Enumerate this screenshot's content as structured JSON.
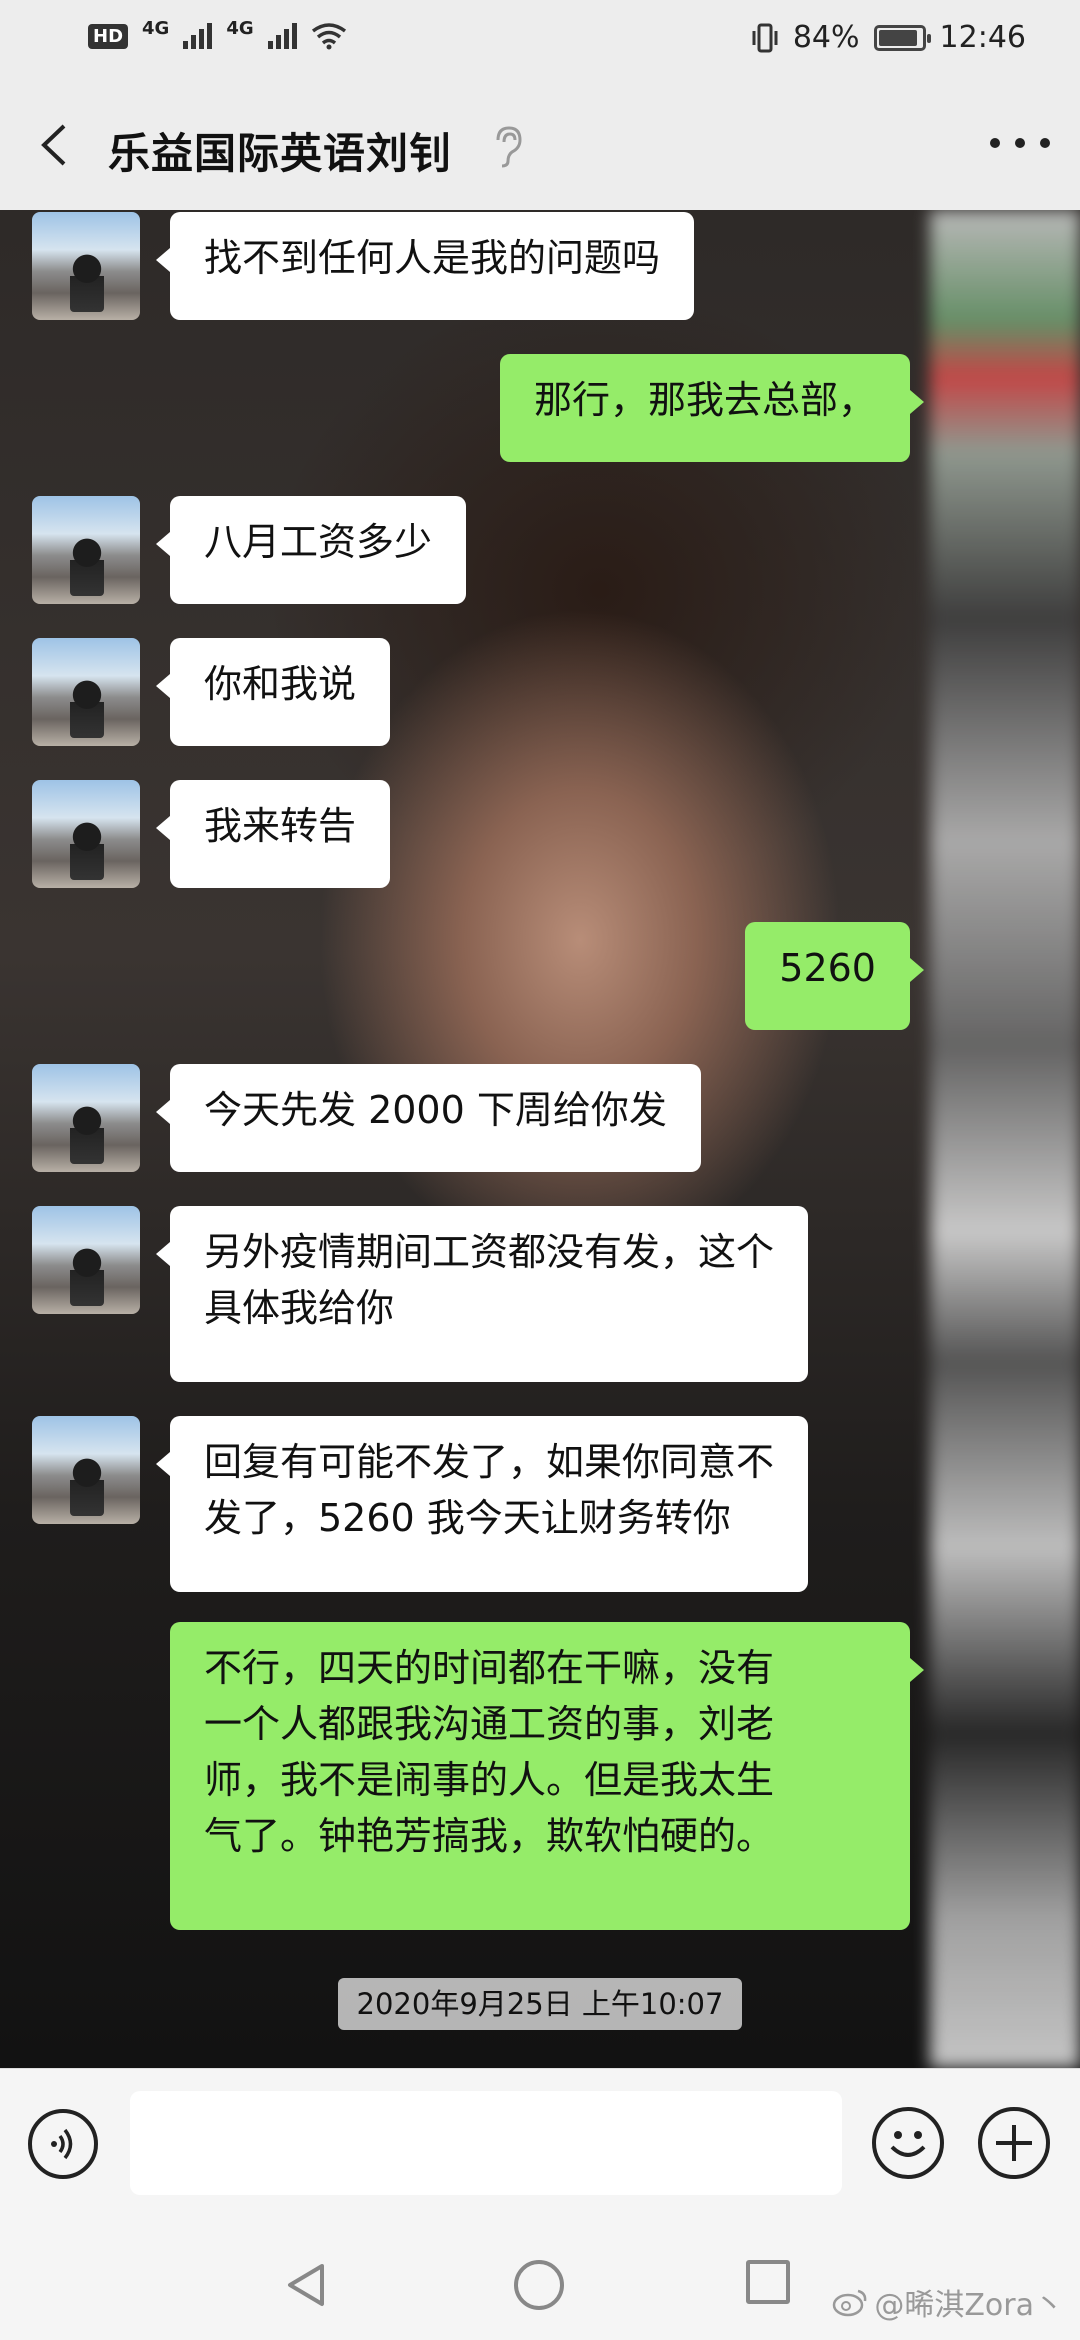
{
  "status_bar": {
    "hd_badge": "HD",
    "network_1": "4G",
    "network_2": "4G",
    "battery_text": "84%",
    "battery_level": 0.84,
    "time": "12:46"
  },
  "header": {
    "title": "乐益国际英语刘钊",
    "back_icon": "chevron-left-icon",
    "ear_icon": "earpiece-mode-icon",
    "more_icon": "more-dots-icon"
  },
  "messages": [
    {
      "side": "left",
      "text": "找不到任何人是我的问题吗"
    },
    {
      "side": "right",
      "text": "那行，那我去总部，"
    },
    {
      "side": "left",
      "text": "八月工资多少"
    },
    {
      "side": "left",
      "text": "你和我说"
    },
    {
      "side": "left",
      "text": "我来转告"
    },
    {
      "side": "right",
      "text": "5260"
    },
    {
      "side": "left",
      "text": "今天先发 2000 下周给你发"
    },
    {
      "side": "left",
      "text": "另外疫情期间工资都没有发，这个\n具体我给你"
    },
    {
      "side": "left",
      "text": "回复有可能不发了，如果你同意不\n发了，5260 我今天让财务转你"
    },
    {
      "side": "right",
      "text": "不行，四天的时间都在干嘛，没有\n一个人都跟我沟通工资的事，刘老\n师，我不是闹事的人。但是我太生\n气了。钟艳芳搞我，欺软怕硬的。"
    }
  ],
  "timestamp": "2020年9月25日 上午10:07",
  "input_bar": {
    "voice_icon": "voice-input-icon",
    "input_value": "",
    "emoji_icon": "emoji-icon",
    "plus_icon": "plus-circle-icon"
  },
  "watermark": "@晞淇Zora丶",
  "colors": {
    "bubble_sent": "#95ec69",
    "bubble_received": "#ffffff",
    "bar_background": "#ededed"
  }
}
